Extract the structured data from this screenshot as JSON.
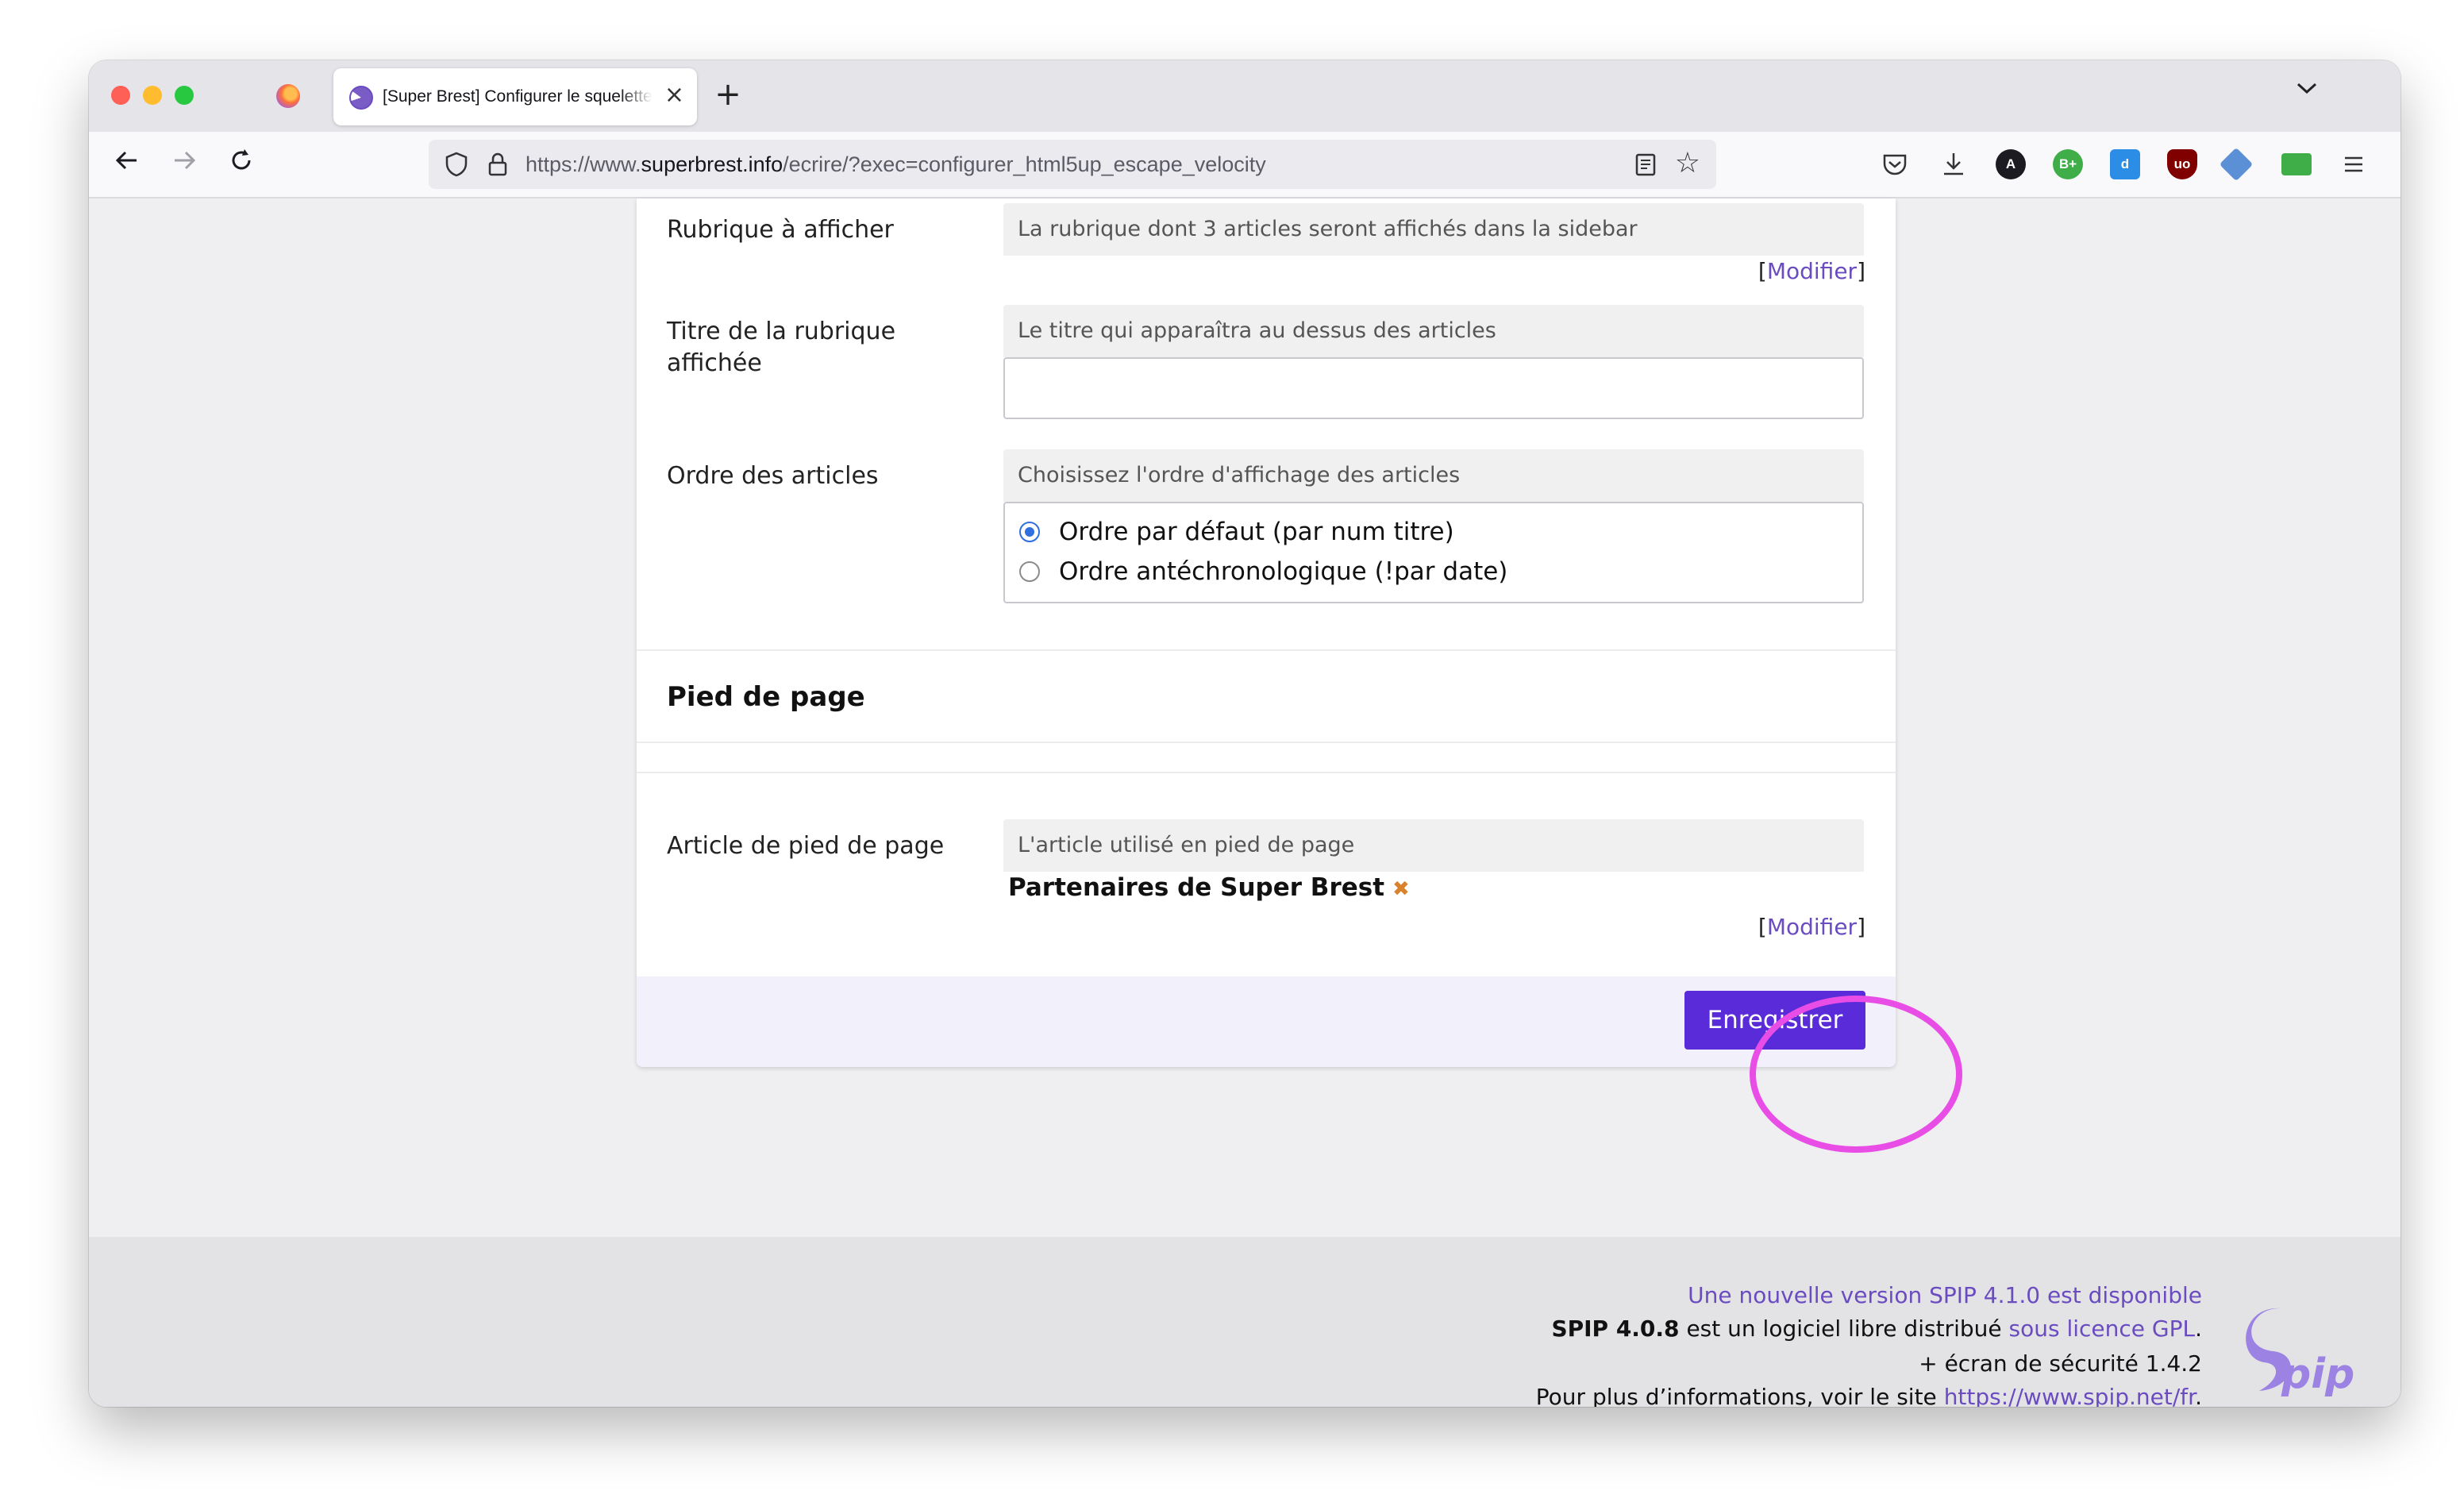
{
  "browser": {
    "tab_title": "[Super Brest] Configurer le squelette",
    "url_prefix": "https://www.",
    "url_domain": "superbrest.info",
    "url_path": "/ecrire/?exec=configurer_html5up_escape_velocity",
    "toolbar_icons": [
      "pocket-icon",
      "download-icon",
      "a-extension-icon",
      "bplus-extension-icon",
      "d-extension-icon",
      "ublock-icon",
      "diamond-extension-icon",
      "cash-extension-icon",
      "menu-icon"
    ]
  },
  "form": {
    "rubrique": {
      "label": "Rubrique à afficher",
      "explication": "La rubrique dont 3 articles seront affichés dans la sidebar",
      "modifier": "Modifier"
    },
    "titre_rubrique": {
      "label": "Titre de la rubrique affichée",
      "explication": "Le titre qui apparaîtra au dessus des articles",
      "value": ""
    },
    "ordre": {
      "label": "Ordre des articles",
      "explication": "Choisissez l'ordre d'affichage des articles",
      "options": [
        {
          "label": "Ordre par défaut (par num titre)",
          "checked": true
        },
        {
          "label": "Ordre antéchronologique (!par date)",
          "checked": false
        }
      ]
    },
    "section_footer": "Pied de page",
    "article_pied": {
      "label": "Article de pied de page",
      "explication": "L'article utilisé en pied de page",
      "selected": "Partenaires de Super Brest",
      "modifier": "Modifier"
    },
    "submit_label": "Enregistrer"
  },
  "footer": {
    "update_notice": "Une nouvelle version SPIP 4.1.0 est disponible",
    "version": "SPIP 4.0.8",
    "license_text": " est un logiciel libre distribué ",
    "license_link": "sous licence GPL",
    "security": "+ écran de sécurité 1.4.2",
    "info_text": "Pour plus d’informations, voir le site ",
    "info_link": "https://www.spip.net/fr",
    "logo_text": "Spip"
  }
}
